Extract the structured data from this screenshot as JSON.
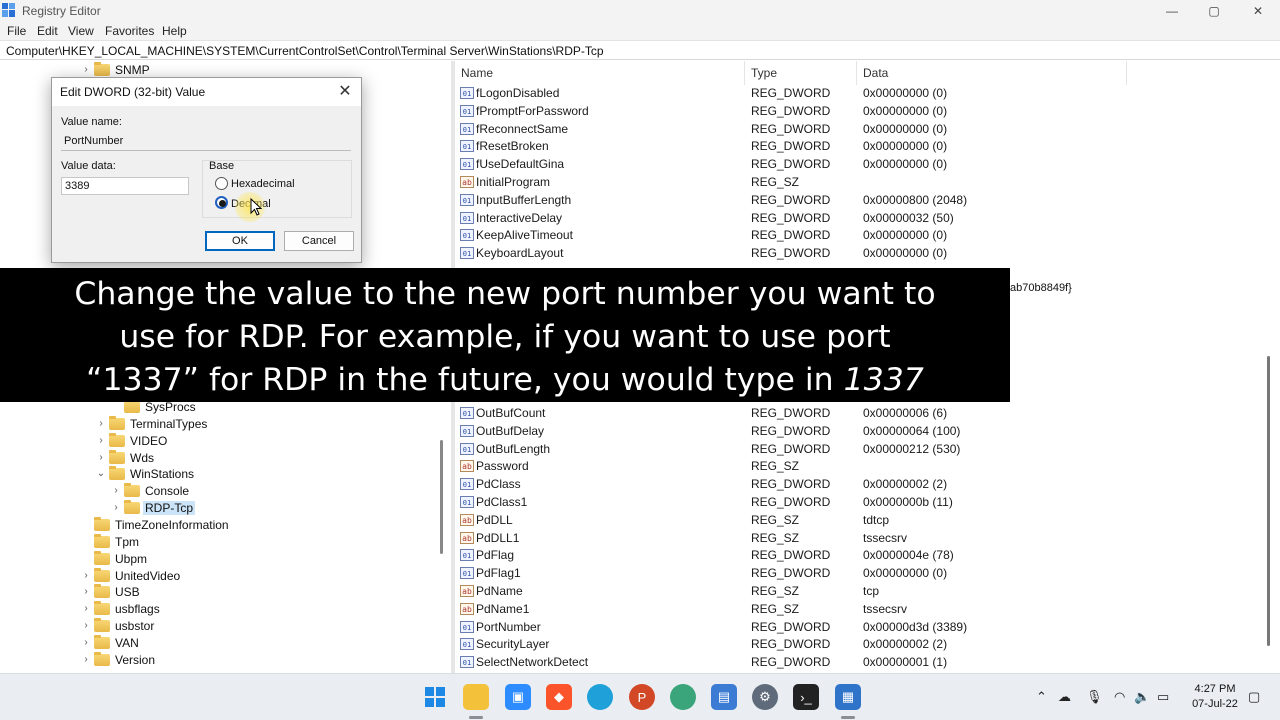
{
  "window": {
    "title": "Registry Editor",
    "minimize": "—",
    "maximize": "▢",
    "close": "✕"
  },
  "menu": [
    "File",
    "Edit",
    "View",
    "Favorites",
    "Help"
  ],
  "address": "Computer\\HKEY_LOCAL_MACHINE\\SYSTEM\\CurrentControlSet\\Control\\Terminal Server\\WinStations\\RDP-Tcp",
  "tree": {
    "items": [
      {
        "label": "SNMP",
        "expander": "›"
      },
      {
        "label": "SysProcs",
        "expander": ""
      },
      {
        "label": "TerminalTypes",
        "expander": "›"
      },
      {
        "label": "VIDEO",
        "expander": "›"
      },
      {
        "label": "Wds",
        "expander": "›"
      },
      {
        "label": "WinStations",
        "expander": "⌄"
      },
      {
        "label": "Console",
        "expander": "›"
      },
      {
        "label": "RDP-Tcp",
        "expander": "›"
      },
      {
        "label": "TimeZoneInformation",
        "expander": ""
      },
      {
        "label": "Tpm",
        "expander": ""
      },
      {
        "label": "Ubpm",
        "expander": ""
      },
      {
        "label": "UnitedVideo",
        "expander": "›"
      },
      {
        "label": "USB",
        "expander": "›"
      },
      {
        "label": "usbflags",
        "expander": "›"
      },
      {
        "label": "usbstor",
        "expander": "›"
      },
      {
        "label": "VAN",
        "expander": "›"
      },
      {
        "label": "Version",
        "expander": "›"
      }
    ]
  },
  "values": {
    "columns": [
      "Name",
      "Type",
      "Data"
    ],
    "rows_top": [
      {
        "icon": "dword",
        "name": "fLogonDisabled",
        "type": "REG_DWORD",
        "data": "0x00000000 (0)"
      },
      {
        "icon": "dword",
        "name": "fPromptForPassword",
        "type": "REG_DWORD",
        "data": "0x00000000 (0)"
      },
      {
        "icon": "dword",
        "name": "fReconnectSame",
        "type": "REG_DWORD",
        "data": "0x00000000 (0)"
      },
      {
        "icon": "dword",
        "name": "fResetBroken",
        "type": "REG_DWORD",
        "data": "0x00000000 (0)"
      },
      {
        "icon": "dword",
        "name": "fUseDefaultGina",
        "type": "REG_DWORD",
        "data": "0x00000000 (0)"
      },
      {
        "icon": "sz",
        "name": "InitialProgram",
        "type": "REG_SZ",
        "data": ""
      },
      {
        "icon": "dword",
        "name": "InputBufferLength",
        "type": "REG_DWORD",
        "data": "0x00000800 (2048)"
      },
      {
        "icon": "dword",
        "name": "InteractiveDelay",
        "type": "REG_DWORD",
        "data": "0x00000032 (50)"
      },
      {
        "icon": "dword",
        "name": "KeepAliveTimeout",
        "type": "REG_DWORD",
        "data": "0x00000000 (0)"
      },
      {
        "icon": "dword",
        "name": "KeyboardLayout",
        "type": "REG_DWORD",
        "data": "0x00000000 (0)"
      }
    ],
    "partial_data": "ab70b8849f}",
    "rows_bottom": [
      {
        "icon": "dword",
        "name": "OutBufCount",
        "type": "REG_DWORD",
        "data": "0x00000006 (6)"
      },
      {
        "icon": "dword",
        "name": "OutBufDelay",
        "type": "REG_DWORD",
        "data": "0x00000064 (100)"
      },
      {
        "icon": "dword",
        "name": "OutBufLength",
        "type": "REG_DWORD",
        "data": "0x00000212 (530)"
      },
      {
        "icon": "sz",
        "name": "Password",
        "type": "REG_SZ",
        "data": ""
      },
      {
        "icon": "dword",
        "name": "PdClass",
        "type": "REG_DWORD",
        "data": "0x00000002 (2)"
      },
      {
        "icon": "dword",
        "name": "PdClass1",
        "type": "REG_DWORD",
        "data": "0x0000000b (11)"
      },
      {
        "icon": "sz",
        "name": "PdDLL",
        "type": "REG_SZ",
        "data": "tdtcp"
      },
      {
        "icon": "sz",
        "name": "PdDLL1",
        "type": "REG_SZ",
        "data": "tssecsrv"
      },
      {
        "icon": "dword",
        "name": "PdFlag",
        "type": "REG_DWORD",
        "data": "0x0000004e (78)"
      },
      {
        "icon": "dword",
        "name": "PdFlag1",
        "type": "REG_DWORD",
        "data": "0x00000000 (0)"
      },
      {
        "icon": "sz",
        "name": "PdName",
        "type": "REG_SZ",
        "data": "tcp"
      },
      {
        "icon": "sz",
        "name": "PdName1",
        "type": "REG_SZ",
        "data": "tssecsrv"
      },
      {
        "icon": "dword",
        "name": "PortNumber",
        "type": "REG_DWORD",
        "data": "0x00000d3d (3389)"
      },
      {
        "icon": "dword",
        "name": "SecurityLayer",
        "type": "REG_DWORD",
        "data": "0x00000002 (2)"
      },
      {
        "icon": "dword",
        "name": "SelectNetworkDetect",
        "type": "REG_DWORD",
        "data": "0x00000001 (1)"
      }
    ]
  },
  "dialog": {
    "title": "Edit DWORD (32-bit) Value",
    "close": "✕",
    "value_name_label": "Value name:",
    "value_name": "PortNumber",
    "value_data_label": "Value data:",
    "value_data": "3389",
    "base_label": "Base",
    "hex_label": "Hexadecimal",
    "dec_label": "Decimal",
    "selected_base": "Decimal",
    "ok": "OK",
    "cancel": "Cancel"
  },
  "caption": {
    "line1": "Change the value to the new port number you want to",
    "line2": "use for RDP. For example, if you want to use port",
    "line3_text": "“1337” for RDP in the future, you would type in",
    "line3_em": "1337"
  },
  "taskbar": {
    "apps": [
      "start-icon",
      "file-explorer-icon",
      "zoom-icon",
      "brave-icon",
      "edge-icon",
      "powerpoint-icon",
      "browser-icon",
      "remote-desktop-icon",
      "settings-icon",
      "terminal-icon",
      "registry-editor-icon"
    ],
    "time": "4:27 PM",
    "date": "07-Jul-22"
  },
  "colors": {
    "accent": "#0067c0",
    "selection": "#cce4f7",
    "caption_bg": "#000000",
    "folder": "#e9b949"
  }
}
